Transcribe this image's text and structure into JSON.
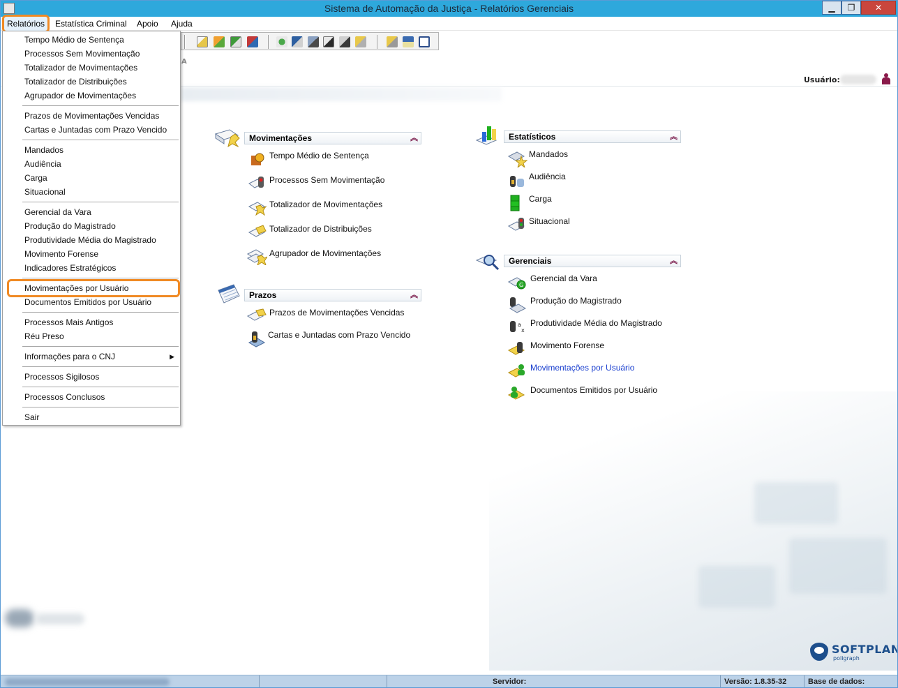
{
  "window": {
    "title": "Sistema de Automação da Justiça - Relatórios Gerenciais",
    "minimize": "▁",
    "maximize": "❐",
    "close": "✕"
  },
  "menubar": [
    "Relatórios",
    "Estatística Criminal",
    "Apoio",
    "Ajuda"
  ],
  "header": {
    "faded_letter": "A",
    "user_label": "Usuário:"
  },
  "dropdown": {
    "groups": [
      [
        "Tempo Médio de Sentença",
        "Processos Sem Movimentação",
        "Totalizador de Movimentações",
        "Totalizador de Distribuições",
        "Agrupador de Movimentações"
      ],
      [
        "Prazos de Movimentações Vencidas",
        "Cartas e Juntadas com Prazo Vencido"
      ],
      [
        "Mandados",
        "Audiência",
        "Carga",
        "Situacional"
      ],
      [
        "Gerencial da Vara",
        "Produção do Magistrado",
        "Produtividade Média do Magistrado",
        "Movimento Forense",
        "Indicadores Estratégicos"
      ],
      [
        "Movimentações por Usuário",
        "Documentos Emitidos por Usuário"
      ],
      [
        "Processos Mais Antigos",
        "Réu Preso"
      ],
      [
        "Informações para o CNJ"
      ],
      [
        "Processos Sigilosos"
      ],
      [
        "Processos Conclusos"
      ],
      [
        "Sair"
      ]
    ],
    "submenu_arrow": "▶"
  },
  "sections": {
    "movimentacoes": {
      "title": "Movimentações",
      "items": [
        "Tempo Médio de Sentença",
        "Processos Sem Movimentação",
        "Totalizador de Movimentações",
        "Totalizador de Distribuições",
        "Agrupador de Movimentações"
      ]
    },
    "prazos": {
      "title": "Prazos",
      "items": [
        "Prazos de Movimentações Vencidas",
        "Cartas e Juntadas com Prazo Vencido"
      ]
    },
    "estatisticos": {
      "title": "Estatísticos",
      "items": [
        "Mandados",
        "Audiência",
        "Carga",
        "Situacional"
      ]
    },
    "gerenciais": {
      "title": "Gerenciais",
      "items": [
        "Gerencial da Vara",
        "Produção do Magistrado",
        "Produtividade Média do Magistrado",
        "Movimento Forense",
        "Movimentações por Usuário",
        "Documentos Emitidos por Usuário"
      ]
    },
    "collapse_glyph": "︽"
  },
  "logo": {
    "brand": "SOFTPLAN",
    "sub": "poligraph"
  },
  "statusbar": {
    "servidor": "Servidor:",
    "versao": "Versão: 1.8.35-32",
    "base": "Base de dados:"
  }
}
